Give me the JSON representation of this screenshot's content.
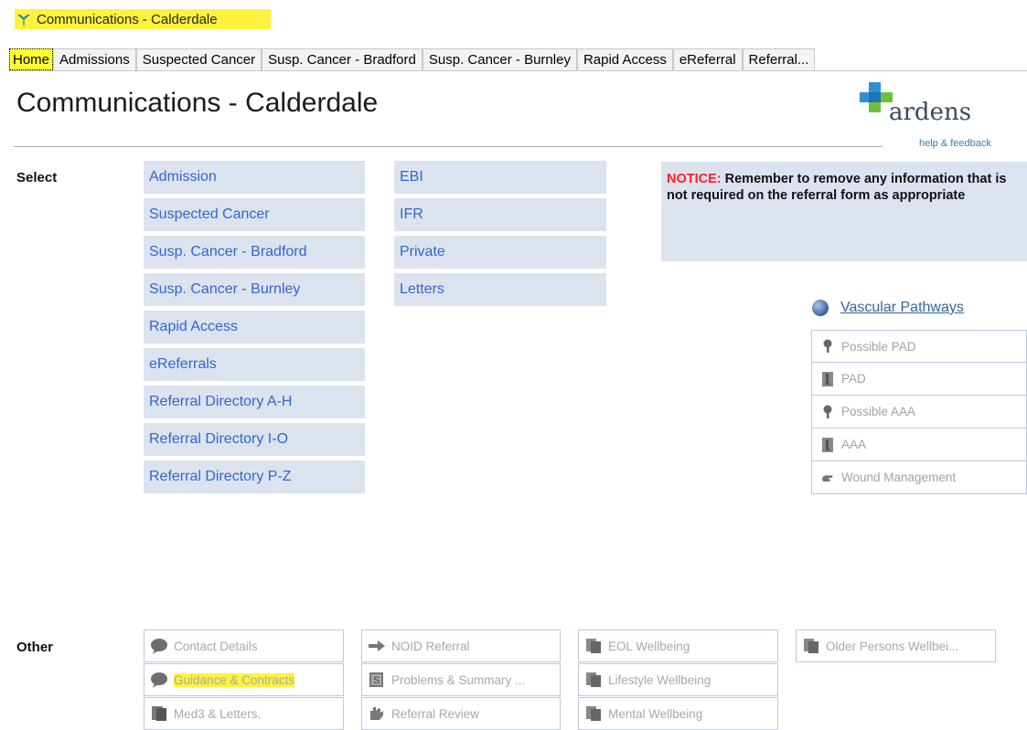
{
  "window": {
    "title": "Communications - Calderdale",
    "icon": "ardens-app-icon"
  },
  "tabs": [
    {
      "label": "Home"
    },
    {
      "label": "Admissions"
    },
    {
      "label": "Suspected Cancer"
    },
    {
      "label": "Susp. Cancer - Bradford"
    },
    {
      "label": "Susp. Cancer - Burnley"
    },
    {
      "label": "Rapid Access"
    },
    {
      "label": "eReferral"
    },
    {
      "label": "Referral..."
    }
  ],
  "header": {
    "title": "Communications - Calderdale"
  },
  "logo": {
    "word": "ardens",
    "help": "help & feedback"
  },
  "select": {
    "label": "Select",
    "col1": [
      "Admission",
      "Suspected Cancer",
      "Susp. Cancer - Bradford",
      "Susp. Cancer - Burnley",
      "Rapid Access",
      "eReferrals",
      "Referral Directory A-H",
      "Referral Directory I-O",
      "Referral Directory P-Z"
    ],
    "col2": [
      "EBI",
      "IFR",
      "Private",
      "Letters"
    ]
  },
  "notice": {
    "prefix": "NOTICE:",
    "text": " Remember to remove any information that is not required on the referral form as appropriate"
  },
  "vascular": {
    "title": "Vascular Pathways",
    "items": [
      "Possible PAD",
      "PAD",
      "Possible AAA",
      "AAA",
      "Wound Management"
    ]
  },
  "other": {
    "label": "Other",
    "items": [
      "Contact Details",
      "Guidance & Contracts",
      "Med3 & Letters.",
      "NOID Referral",
      "Problems & Summary ...",
      "Referral Review",
      "EOL Wellbeing",
      "Lifestyle Wellbeing",
      "Mental Wellbeing",
      "Older Persons Wellbei..."
    ]
  },
  "colors": {
    "accent_blue": "#3366cc",
    "button_bg": "#dce3ef",
    "highlight": "#fff23c",
    "notice_red": "#ff2020"
  }
}
